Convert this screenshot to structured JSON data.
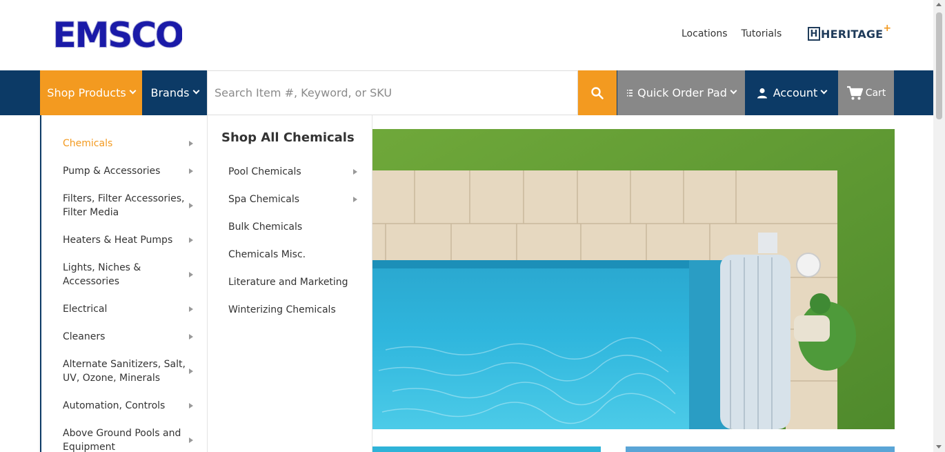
{
  "header": {
    "logo_text": "EMSCO",
    "links": [
      "Locations",
      "Tutorials"
    ],
    "partner_logo_text": "HERITAGE",
    "partner_logo_plus": "+"
  },
  "nav": {
    "shop_products": "Shop Products",
    "brands": "Brands",
    "search_placeholder": "Search Item #, Keyword, or SKU",
    "quick_order": "Quick Order Pad",
    "account": "Account",
    "cart": "Cart"
  },
  "menu": {
    "categories": [
      {
        "label": "Chemicals",
        "label2": "",
        "active": true
      },
      {
        "label": "Pump & Accessories",
        "label2": ""
      },
      {
        "label": "Filters, Filter Accessories,",
        "label2": "Filter Media"
      },
      {
        "label": "Heaters & Heat Pumps",
        "label2": ""
      },
      {
        "label": "Lights, Niches &",
        "label2": "Accessories"
      },
      {
        "label": "Electrical",
        "label2": ""
      },
      {
        "label": "Cleaners",
        "label2": ""
      },
      {
        "label": "Alternate Sanitizers, Salt,",
        "label2": "UV, Ozone, Minerals"
      },
      {
        "label": "Automation, Controls",
        "label2": ""
      },
      {
        "label": "Above Ground Pools and",
        "label2": "Equipment"
      }
    ],
    "submenu_title": "Shop All Chemicals",
    "submenu_items": [
      {
        "label": "Pool Chemicals",
        "has_children": true
      },
      {
        "label": "Spa Chemicals",
        "has_children": true
      },
      {
        "label": "Bulk Chemicals",
        "has_children": false
      },
      {
        "label": "Chemicals Misc.",
        "has_children": false
      },
      {
        "label": "Literature and Marketing",
        "has_children": false
      },
      {
        "label": "Winterizing Chemicals",
        "has_children": false
      }
    ]
  },
  "colors": {
    "navy": "#0c3a66",
    "orange": "#f39a20",
    "gray": "#888888",
    "logo_blue": "#1a1aa8"
  }
}
